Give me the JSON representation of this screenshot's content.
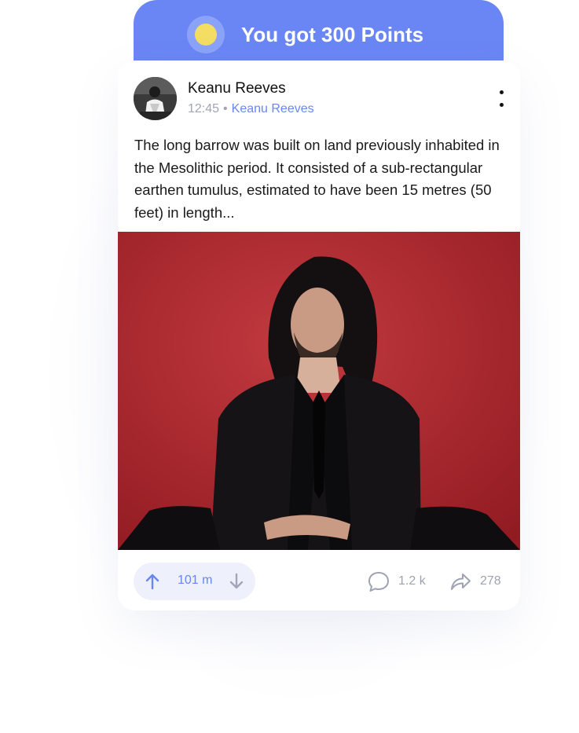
{
  "banner": {
    "text": "You got 300 Points",
    "coin_icon": "coin-icon"
  },
  "post": {
    "author_name": "Keanu Reeves",
    "time": "12:45",
    "meta_separator": "•",
    "channel": "Keanu Reeves",
    "body": "The long barrow was built on land previously inhabited in the Mesolithic period. It consisted of a sub-rectangular earthen tumulus, estimated to have been 15 metres (50 feet) in length...",
    "menu_icon": "more-vertical-icon"
  },
  "actions": {
    "votes": "101 m",
    "comments": "1.2 k",
    "shares": "278",
    "upvote_icon": "arrow-up-icon",
    "downvote_icon": "arrow-down-icon",
    "comment_icon": "comment-icon",
    "share_icon": "share-icon"
  },
  "colors": {
    "accent": "#6a86f4",
    "coin": "#f3dd63",
    "photo_background": "#a52027",
    "muted_text": "#9ea2b3"
  }
}
